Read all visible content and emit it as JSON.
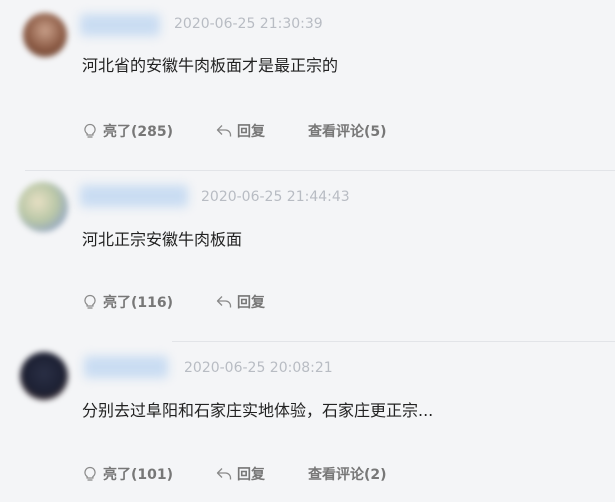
{
  "comments": [
    {
      "time": "2020-06-25 21:30:39",
      "text": "河北省的安徽牛肉板面才是最正宗的",
      "like_label": "亮了(285)",
      "reply_label": "回复",
      "view_label": "查看评论(5)"
    },
    {
      "time": "2020-06-25 21:44:43",
      "text": "河北正宗安徽牛肉板面",
      "like_label": "亮了(116)",
      "reply_label": "回复"
    },
    {
      "time": "2020-06-25 20:08:21",
      "text": "分别去过阜阳和石家庄实地体验，石家庄更正宗...",
      "like_label": "亮了(101)",
      "reply_label": "回复",
      "view_label": "查看评论(2)"
    }
  ],
  "colors": {
    "background": "#f4f5f7",
    "text": "#222222",
    "meta": "#b8bcc3",
    "action": "#777777"
  },
  "icons": [
    "lightbulb-icon",
    "reply-arrow-icon"
  ]
}
